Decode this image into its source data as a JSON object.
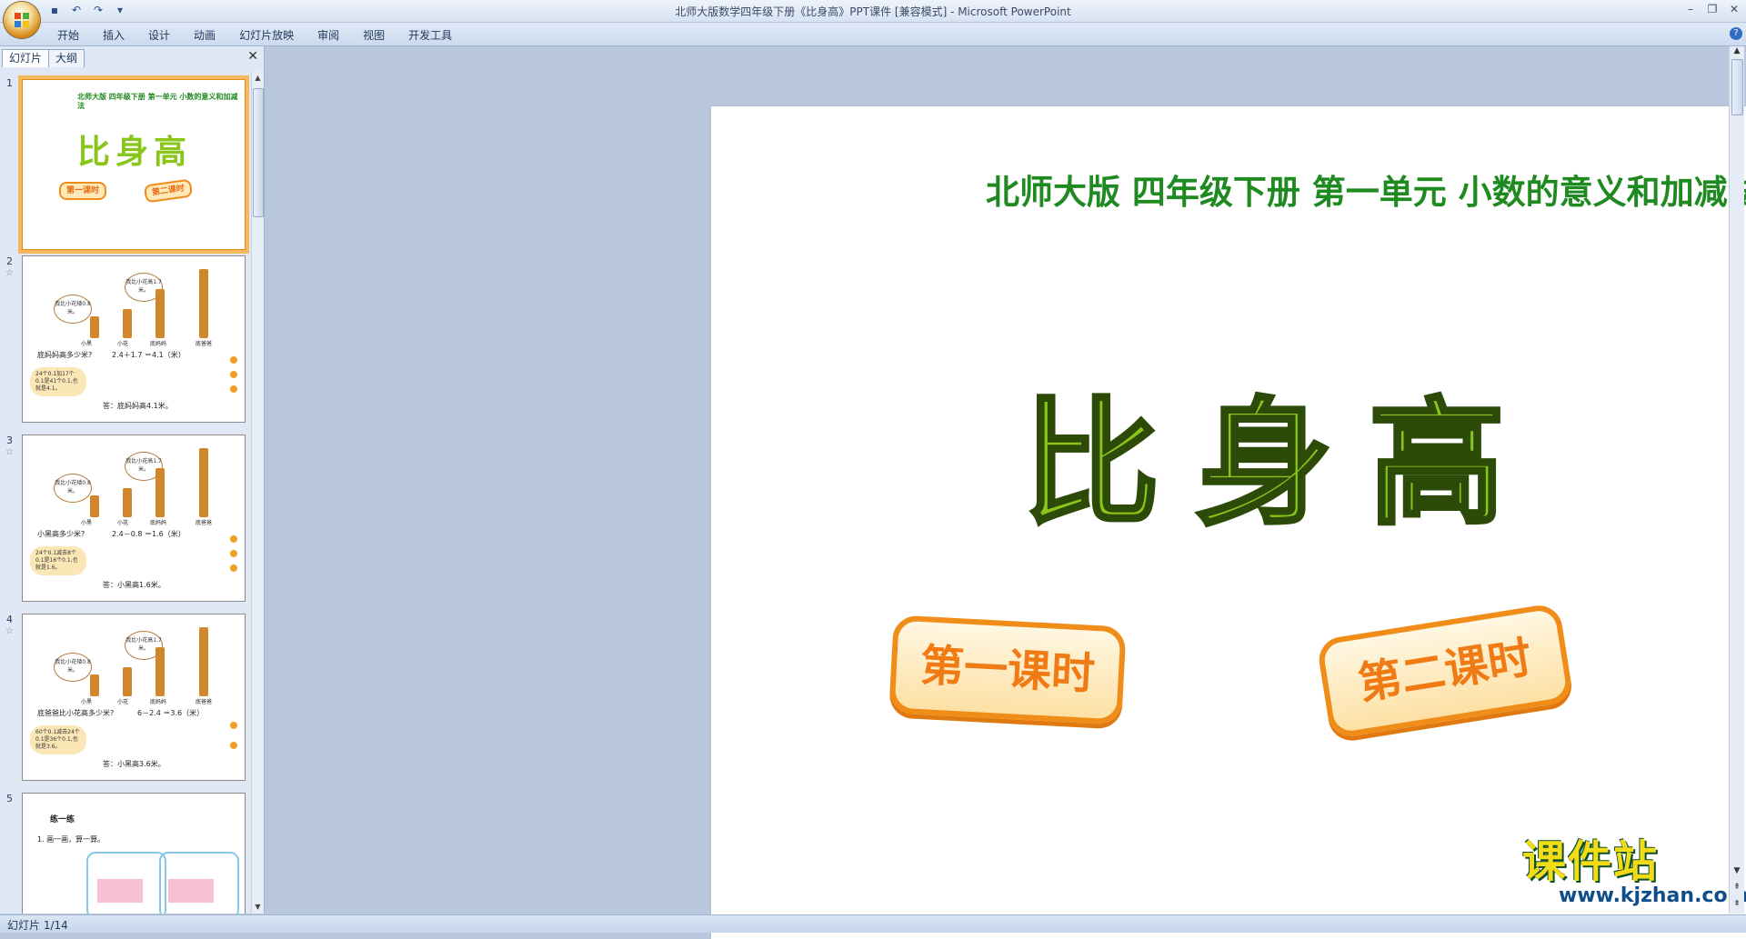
{
  "window": {
    "title": "北师大版数学四年级下册《比身高》PPT课件 [兼容模式] - Microsoft PowerPoint"
  },
  "ribbon": {
    "tabs": [
      "开始",
      "插入",
      "设计",
      "动画",
      "幻灯片放映",
      "审阅",
      "视图",
      "开发工具"
    ]
  },
  "panel": {
    "tabs": [
      "幻灯片",
      "大纲"
    ],
    "thumbs": [
      {
        "num": "1",
        "title": "北师大版  四年级下册  第一单元  小数的意义和加减法",
        "big": "比身高",
        "btn1": "第一课时",
        "btn2": "第二课时"
      },
      {
        "num": "2",
        "q": "底妈妈高多少米?",
        "eq": "2.4＋1.7 ＝4.1（米）",
        "ans": "答：底妈妈高4.1米。",
        "bubble1": "我比小花矮0.8米。",
        "bubble2": "我比小花高1.7米。",
        "cloud": "24个0.1加17个0.1是41个0.1,也就是4.1。",
        "names": [
          "小黑",
          "小花",
          "底妈妈",
          "底爸爸"
        ]
      },
      {
        "num": "3",
        "q": "小黑高多少米?",
        "eq": "2.4－0.8 ＝1.6（米）",
        "ans": "答：小黑高1.6米。",
        "bubble1": "我比小花矮0.8米。",
        "bubble2": "我比小花高1.7米。",
        "cloud": "24个0.1减去8个0.1是16个0.1,也就是1.6。",
        "names": [
          "小黑",
          "小花",
          "底妈妈",
          "底爸爸"
        ]
      },
      {
        "num": "4",
        "q": "底爸爸比小花高多少米?",
        "eq": "6－2.4 ＝3.6（米）",
        "ans": "答：小黑高3.6米。",
        "bubble1": "我比小花矮0.8米。",
        "bubble2": "我比小花高1.7米。",
        "cloud": "60个0.1减去24个0.1是36个0.1,也就是3.6。",
        "names": [
          "小黑",
          "小花",
          "底妈妈",
          "底爸爸"
        ]
      },
      {
        "num": "5",
        "heading": "练一练",
        "line1": "1. 画一画，算一算。"
      }
    ]
  },
  "slide": {
    "title": "北师大版  四年级下册  第一单元  小数的意义和加减法",
    "big_text": "比身高",
    "btn_lesson1": "第一课时",
    "btn_lesson2": "第二课时"
  },
  "watermark": {
    "text": "课件站",
    "url": "www.kjzhan.com"
  },
  "status": {
    "slide_indicator": "幻灯片 1/14"
  },
  "colors": {
    "title_green": "#1e8a20",
    "big_green": "#8ac61a",
    "orange": "#f08c18"
  }
}
